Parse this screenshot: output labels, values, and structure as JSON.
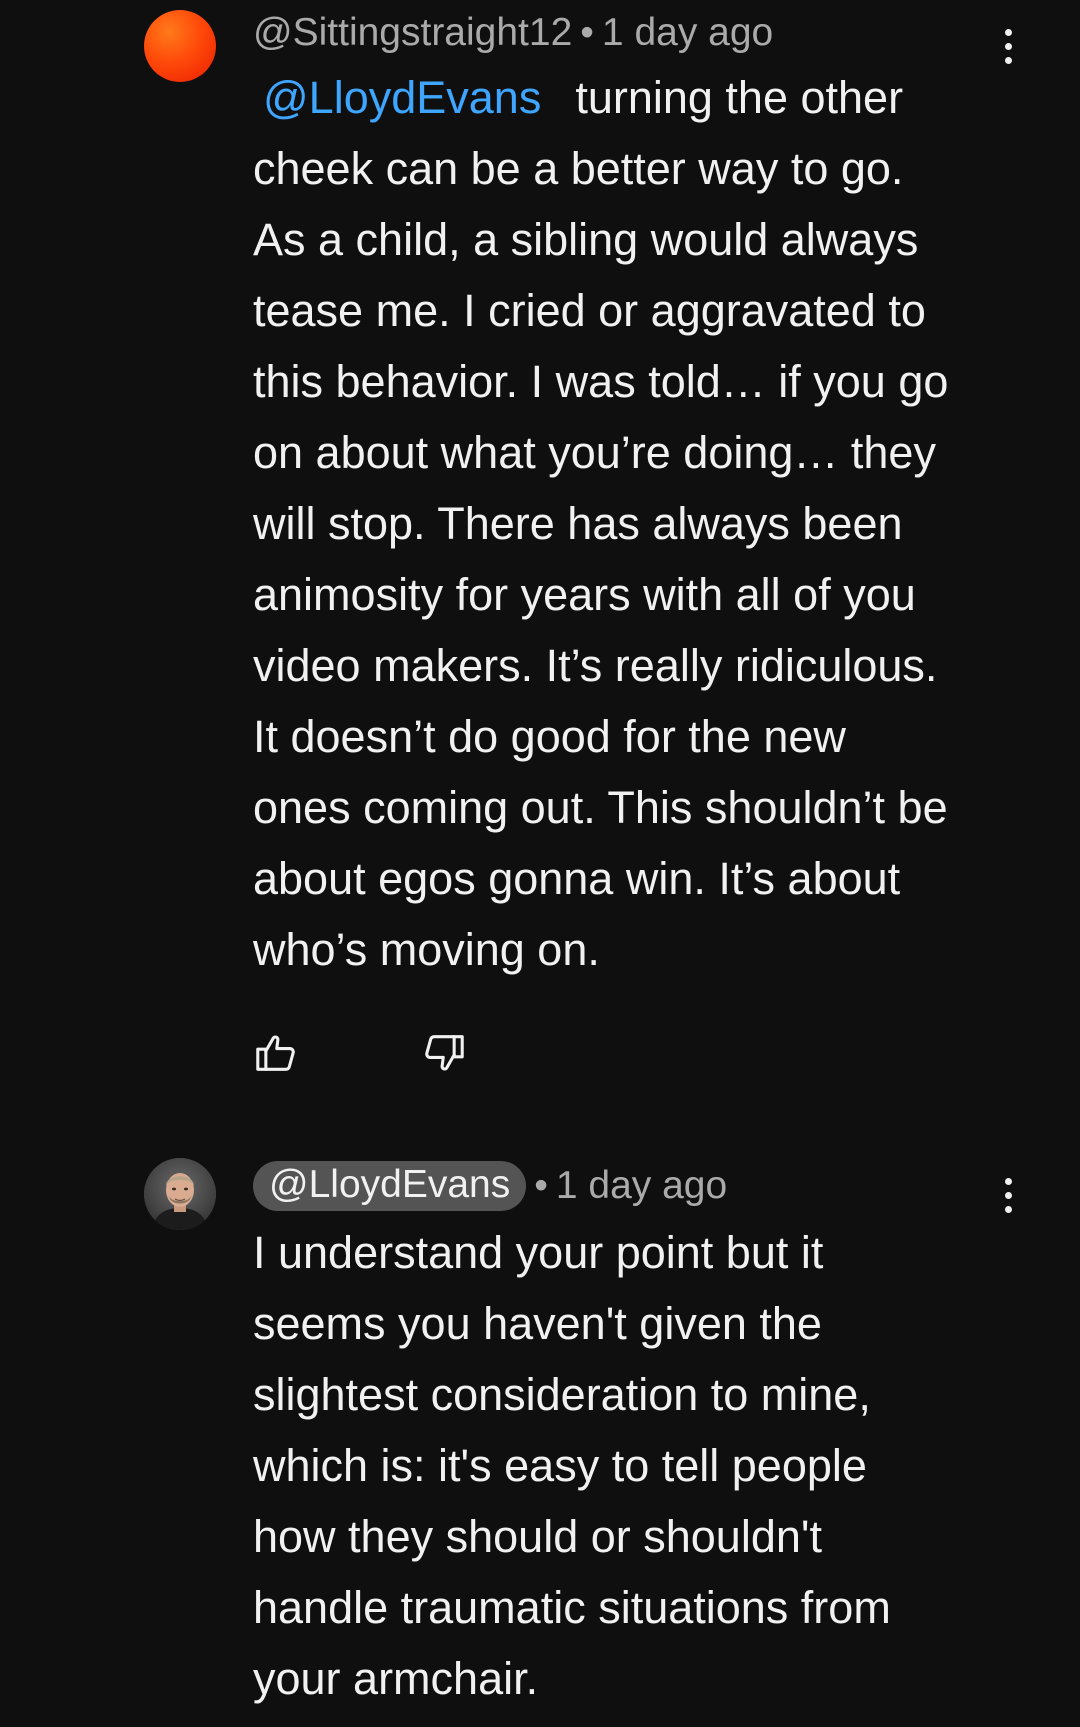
{
  "comments": [
    {
      "author": "@Sittingstraight12",
      "separator": "•",
      "time": "1 day ago",
      "mention": "@LloydEvans",
      "first_line_rest": "turning the other",
      "lines": [
        "cheek can be a better way to go.",
        "As a child, a sibling would always",
        "tease me. I cried or aggravated to",
        "this behavior. I was told… if you go",
        "on about what you’re doing… they",
        "will stop. There has always been",
        "animosity for years with all of you",
        "video makers. It’s really ridiculous.",
        "It doesn’t do good for the new",
        "ones coming out. This shouldn’t be",
        "about egos gonna win. It’s about",
        "who’s moving on."
      ],
      "avatar_color": "#ff4a0a",
      "icons": {
        "menu": "more-vert-icon",
        "like": "thumb-up-icon",
        "dislike": "thumb-down-icon"
      }
    },
    {
      "author": "@LloydEvans",
      "separator": "•",
      "time": "1 day ago",
      "lines": [
        "I understand your point but it",
        "seems you haven't given the",
        "slightest consideration to mine,",
        "which is: it's easy to tell people",
        "how they should or shouldn't",
        "handle traumatic situations from",
        "your armchair."
      ],
      "author_is_creator": true,
      "icons": {
        "menu": "more-vert-icon"
      }
    }
  ],
  "colors": {
    "background": "#0f0f0f",
    "text": "#f1f1f1",
    "meta": "#aaaaaa",
    "mention": "#3ea6ff",
    "creator_pill": "#545454"
  }
}
